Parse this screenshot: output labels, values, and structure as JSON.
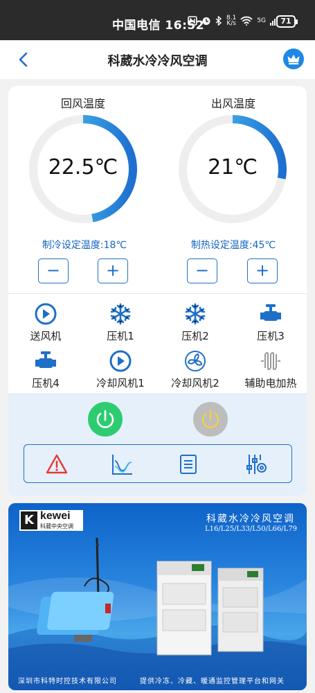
{
  "status_bar": {
    "carrier_time": "中国电信 16:52",
    "net_speed_top": "8.1",
    "net_speed_bottom": "K/s",
    "signal": "5G",
    "battery": "71"
  },
  "header": {
    "title": "科葳水冷冷风空调"
  },
  "gauges": {
    "return_air": {
      "label": "回风温度",
      "value": "22.5℃",
      "fill_fraction": 0.47
    },
    "supply_air": {
      "label": "出风温度",
      "value": "21℃",
      "fill_fraction": 0.28
    }
  },
  "setpoints": {
    "cooling": "制冷设定温度:18℃",
    "heating": "制热设定温度:45℃",
    "minus": "−",
    "plus": "+"
  },
  "devices": [
    {
      "label": "送风机",
      "icon": "play-circle-icon"
    },
    {
      "label": "压机1",
      "icon": "snowflake-icon"
    },
    {
      "label": "压机2",
      "icon": "snowflake-icon"
    },
    {
      "label": "压机3",
      "icon": "valve-icon"
    },
    {
      "label": "压机4",
      "icon": "valve-icon"
    },
    {
      "label": "冷却风机1",
      "icon": "play-circle-icon"
    },
    {
      "label": "冷却风机2",
      "icon": "fan-icon"
    },
    {
      "label": "辅助电加热",
      "icon": "heater-icon"
    }
  ],
  "colors": {
    "accent": "#1e6fc8",
    "gauge_start": "#1e6fd0",
    "gauge_end": "#55d4f2",
    "gauge_track": "#eeeeee",
    "power_on": "#2ecc71",
    "power_off": "#bdbdbd",
    "alarm": "#e53935"
  },
  "banner": {
    "brand": "kewei",
    "brand_sub": "科葳中央空调",
    "title": "科葳水冷冷风空调",
    "models": "L16/L25/L33/L50/L66/L79",
    "footer_left": "深圳市科特时控技术有限公司",
    "footer_right": "提供冷冻、冷藏、暖通监控管理平台和网关"
  }
}
